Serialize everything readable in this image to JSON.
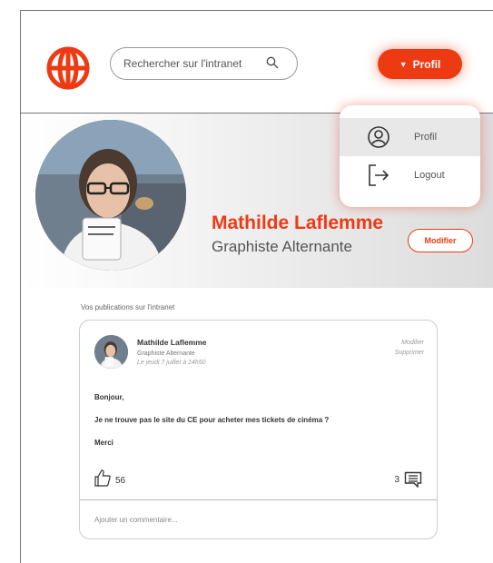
{
  "header": {
    "search": {
      "placeholder": "Rechercher sur l'intranet"
    },
    "profile_button": {
      "label": "Profil"
    }
  },
  "profile_menu": {
    "items": [
      {
        "label": "Profil",
        "icon": "user-circle-icon"
      },
      {
        "label": "Logout",
        "icon": "logout-icon"
      }
    ]
  },
  "profile": {
    "name": "Mathilde Laflemme",
    "role": "Graphiste Alternante",
    "modify_label": "Modifier"
  },
  "publications": {
    "section_label": "Vos publications sur l'intranet",
    "post": {
      "author": "Mathilde Laflemme",
      "role": "Graphiste Alternante",
      "date": "Le jeudi 7 juillet à 14h50",
      "actions": [
        "Modifier",
        "Supprimer"
      ],
      "body": [
        "Bonjour,",
        "Je ne trouve pas le site du CE pour acheter mes tickets de cinéma ?",
        "Merci"
      ],
      "likes": "56",
      "comments": "3",
      "comment_placeholder": "Ajouter un commentaire..."
    }
  },
  "colors": {
    "accent": "#ee3a13",
    "text": "#333333",
    "muted": "#777777"
  }
}
